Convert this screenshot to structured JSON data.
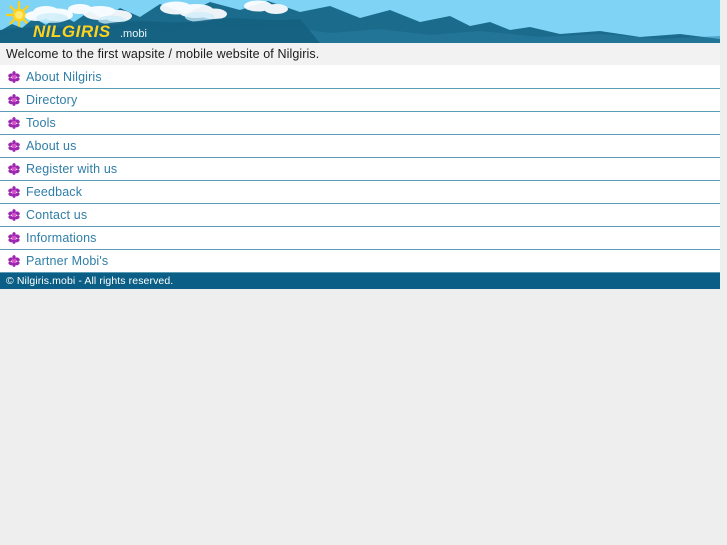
{
  "site": {
    "logo_text": "NILGIRIS",
    "logo_suffix": ".mobi",
    "banner_bg": "#7fd4f5",
    "mountain_color": "#1b6b8c",
    "sun_color": "#ffd21e"
  },
  "welcome": {
    "text": "Welcome to the first wapsite / mobile website of Nilgiris."
  },
  "menu": {
    "bullet_icon": "flower-star-icon",
    "link_color": "#2f7ea8",
    "separator_color": "#5d9cb5",
    "items": [
      {
        "label": "About Nilgiris"
      },
      {
        "label": "Directory"
      },
      {
        "label": "Tools"
      },
      {
        "label": "About us"
      },
      {
        "label": "Register with us"
      },
      {
        "label": "Feedback"
      },
      {
        "label": "Contact us"
      },
      {
        "label": "Informations"
      },
      {
        "label": "Partner Mobi's"
      }
    ]
  },
  "footer": {
    "text": "© Nilgiris.mobi - All rights reserved.",
    "bg": "#0b5f86"
  }
}
